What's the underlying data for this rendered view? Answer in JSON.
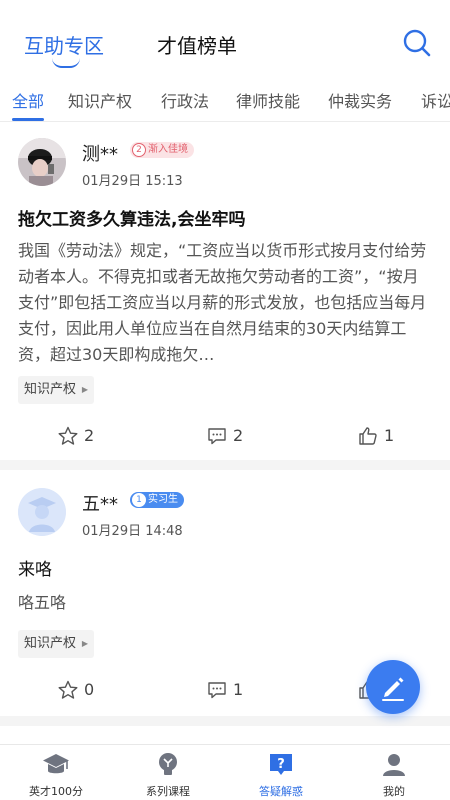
{
  "header": {
    "tabs": [
      {
        "label": "互助专区",
        "active": true
      },
      {
        "label": "才值榜单",
        "active": false
      }
    ]
  },
  "categories": [
    "全部",
    "知识产权",
    "行政法",
    "律师技能",
    "仲裁实务",
    "诉讼"
  ],
  "posts": [
    {
      "username": "测**",
      "badge_level": "2",
      "badge_text": "渐入佳境",
      "time": "01月29日 15:13",
      "title": "拖欠工资多久算违法,会坐牢吗",
      "body": "我国《劳动法》规定，“工资应当以货币形式按月支付给劳动者本人。不得克扣或者无故拖欠劳动者的工资”，“按月支付”即包括工资应当以月薪的形式发放，也包括应当每月支付，因此用人单位应当在自然月结束的30天内结算工资，超过30天即构成拖欠…",
      "tag": "知识产权",
      "stars": "2",
      "comments": "2",
      "likes": "1"
    },
    {
      "username": "五**",
      "badge_level": "1",
      "badge_text": "实习生",
      "time": "01月29日 14:48",
      "title": "来咯",
      "body": "咯五咯",
      "tag": "知识产权",
      "stars": "0",
      "comments": "1"
    }
  ],
  "bottom_nav": [
    {
      "label": "英才100分",
      "icon": "graduation-cap-icon"
    },
    {
      "label": "系列课程",
      "icon": "lightbulb-icon"
    },
    {
      "label": "答疑解惑",
      "icon": "question-icon",
      "active": true
    },
    {
      "label": "我的",
      "icon": "user-icon"
    }
  ],
  "colors": {
    "accent": "#2f6fe4",
    "badge_pink": "#e2606d",
    "badge_blue": "#4a8cf0"
  }
}
